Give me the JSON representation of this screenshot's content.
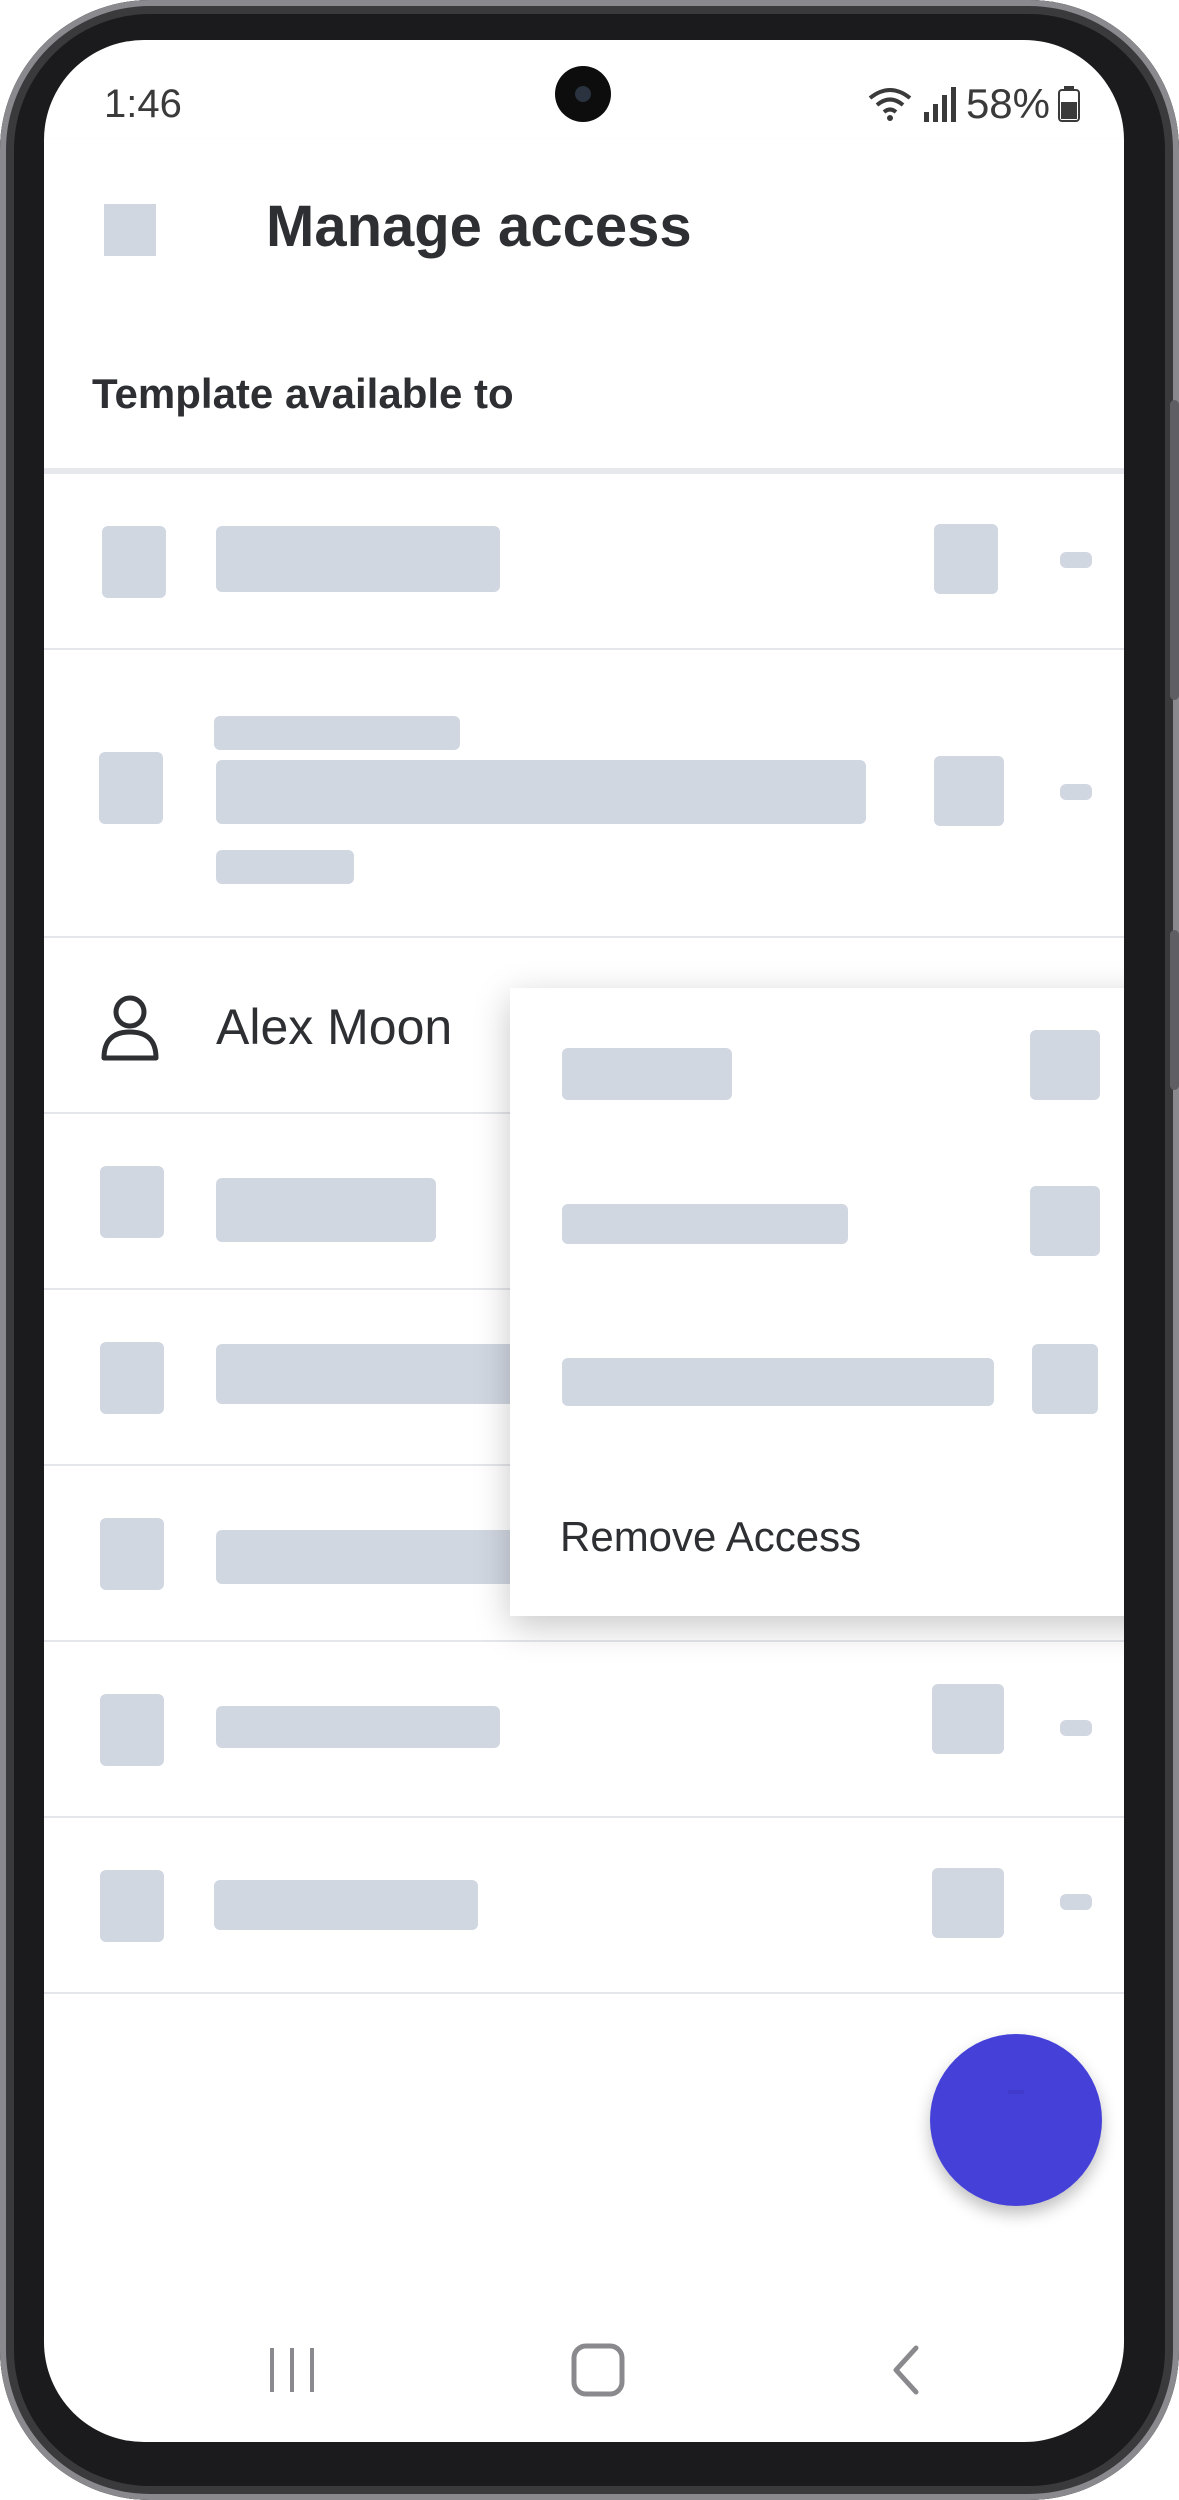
{
  "status_bar": {
    "time": "1:46",
    "battery_percent": "58%",
    "icons": [
      "wifi-icon",
      "signal-icon",
      "battery-icon"
    ]
  },
  "app_bar": {
    "title": "Manage access",
    "leading_icon": "back-icon"
  },
  "section": {
    "title": "Template available to"
  },
  "list": {
    "visible_user": "Alex Moon",
    "user_icon": "person-icon"
  },
  "menu": {
    "remove_label": "Remove Access"
  },
  "fab": {
    "icon": "add-icon"
  },
  "nav_bar": {
    "icons": [
      "recent-apps-icon",
      "home-icon",
      "back-nav-icon"
    ]
  },
  "colors": {
    "skeleton": "#d1d7e1",
    "fab": "#4540d8",
    "text": "#2d2f33"
  }
}
